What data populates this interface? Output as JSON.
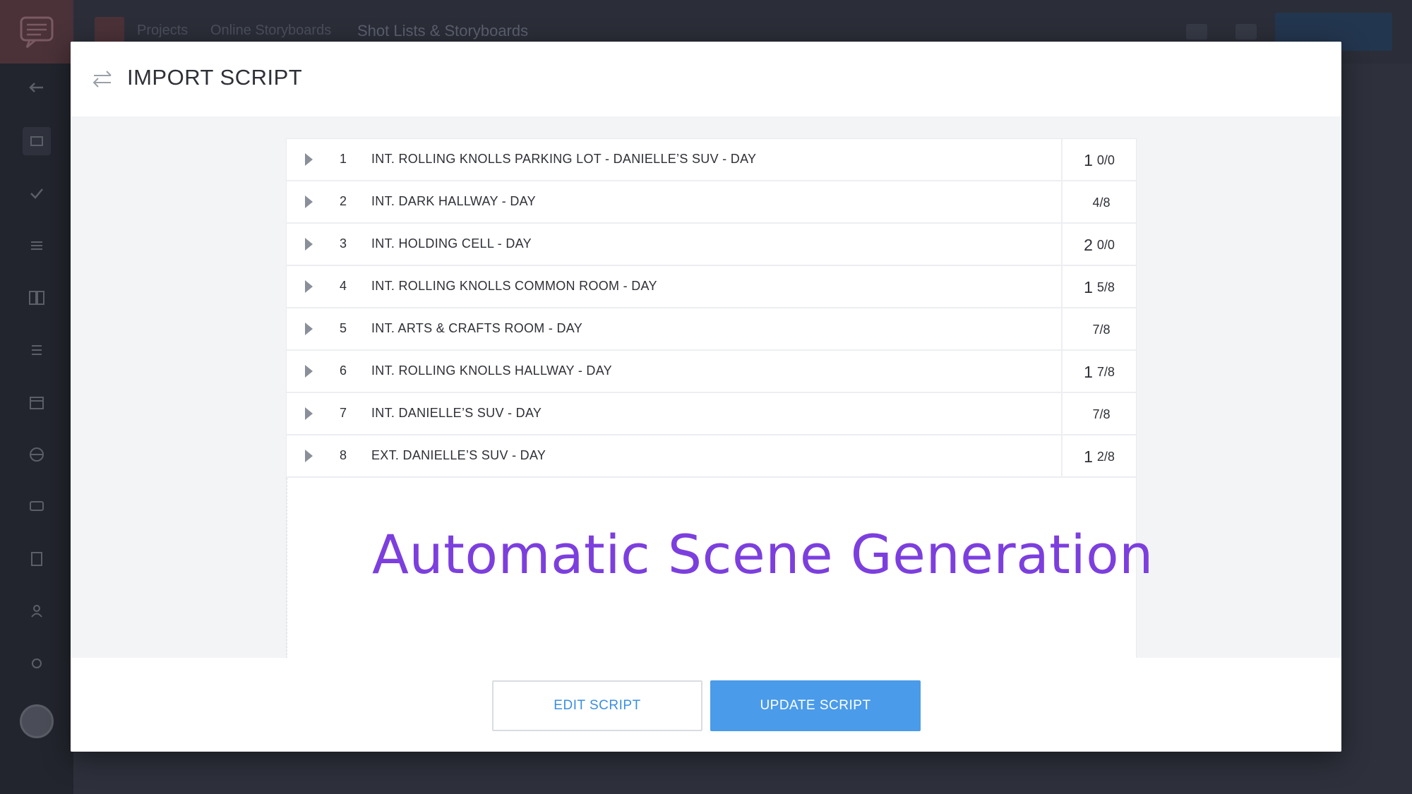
{
  "background": {
    "breadcrumbs": [
      "Projects",
      "Online Storyboards",
      "Shot Lists & Storyboards"
    ],
    "colors": {
      "sidebar": "#23252e",
      "topbar": "#2b2e38",
      "logo_bg": "#4a3238"
    },
    "sidebar_icons": [
      "arrow-left-icon",
      "home-icon",
      "check-icon",
      "menu-icon",
      "storyboard-icon",
      "list-icon",
      "calendar-icon",
      "globe-icon",
      "chat-icon",
      "document-icon",
      "people-icon",
      "settings-icon"
    ]
  },
  "modal": {
    "title": "IMPORT SCRIPT",
    "header_icon": "swap-arrows-icon",
    "scenes": [
      {
        "number": "1",
        "title": "INT. ROLLING KNOLLS PARKING LOT - DANIELLE’S SUV - DAY",
        "length_whole": "1",
        "length_frac": "0/0"
      },
      {
        "number": "2",
        "title": "INT. DARK HALLWAY - DAY",
        "length_whole": "",
        "length_frac": "4/8"
      },
      {
        "number": "3",
        "title": "INT. HOLDING CELL - DAY",
        "length_whole": "2",
        "length_frac": "0/0"
      },
      {
        "number": "4",
        "title": "INT. ROLLING KNOLLS COMMON ROOM - DAY",
        "length_whole": "1",
        "length_frac": "5/8"
      },
      {
        "number": "5",
        "title": "INT. ARTS & CRAFTS ROOM - DAY",
        "length_whole": "",
        "length_frac": "7/8"
      },
      {
        "number": "6",
        "title": "INT. ROLLING KNOLLS HALLWAY - DAY",
        "length_whole": "1",
        "length_frac": "7/8"
      },
      {
        "number": "7",
        "title": "INT. DANIELLE’S SUV - DAY",
        "length_whole": "",
        "length_frac": "7/8"
      },
      {
        "number": "8",
        "title": "EXT. DANIELLE’S SUV - DAY",
        "length_whole": "1",
        "length_frac": "2/8"
      }
    ],
    "promo_text": "Automatic Scene Generation",
    "buttons": {
      "edit": "EDIT SCRIPT",
      "update": "UPDATE SCRIPT"
    },
    "colors": {
      "accent": "#4a9be9",
      "promo": "#7c3fde",
      "text": "#2e3036"
    }
  }
}
